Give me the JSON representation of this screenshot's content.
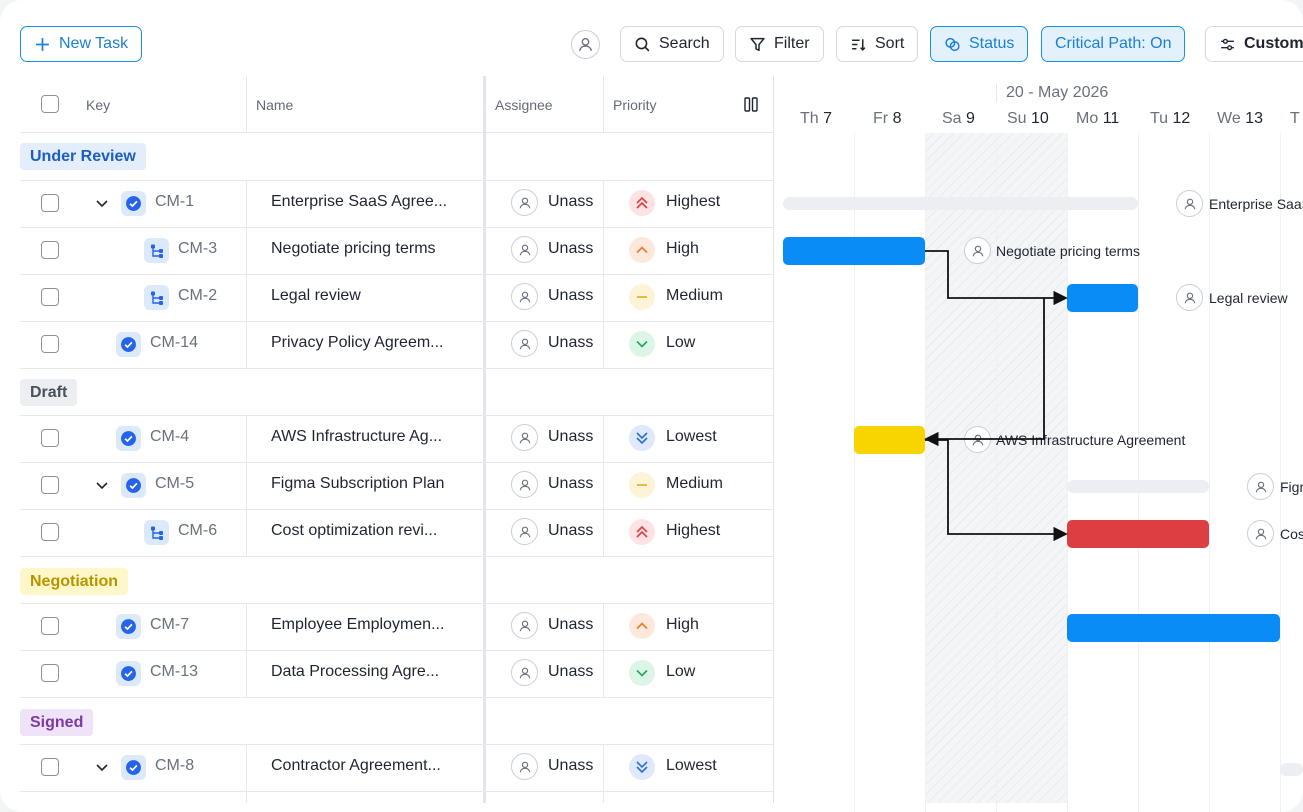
{
  "toolbar": {
    "new_task": "New Task",
    "search": "Search",
    "filter": "Filter",
    "sort": "Sort",
    "status": "Status",
    "critical_path": "Critical Path: On",
    "customize": "Customize"
  },
  "columns": {
    "key": "Key",
    "name": "Name",
    "assignee": "Assignee",
    "priority": "Priority"
  },
  "timeline": {
    "month": "20 - May 2026",
    "days": [
      {
        "dow": "Th",
        "num": "7"
      },
      {
        "dow": "Fr",
        "num": "8"
      },
      {
        "dow": "Sa",
        "num": "9"
      },
      {
        "dow": "Su",
        "num": "10"
      },
      {
        "dow": "Mo",
        "num": "11"
      },
      {
        "dow": "Tu",
        "num": "12"
      },
      {
        "dow": "We",
        "num": "13"
      },
      {
        "dow": "T",
        "num": ""
      }
    ]
  },
  "groups": [
    {
      "label": "Under Review",
      "bg": "#e3edfb",
      "color": "#1d5fbf"
    },
    {
      "label": "Draft",
      "bg": "#eceef1",
      "color": "#4a515c"
    },
    {
      "label": "Negotiation",
      "bg": "#fdf7c9",
      "color": "#b79500"
    },
    {
      "label": "Signed",
      "bg": "#efe3f8",
      "color": "#7b3aa6"
    }
  ],
  "rows": [
    {
      "key": "CM-1",
      "name": "Enterprise SaaS Agree...",
      "assignee": "Unass",
      "priority": "Highest"
    },
    {
      "key": "CM-3",
      "name": "Negotiate pricing terms",
      "assignee": "Unass",
      "priority": "High"
    },
    {
      "key": "CM-2",
      "name": "Legal review",
      "assignee": "Unass",
      "priority": "Medium"
    },
    {
      "key": "CM-14",
      "name": "Privacy Policy Agreem...",
      "assignee": "Unass",
      "priority": "Low"
    },
    {
      "key": "CM-4",
      "name": "AWS Infrastructure Ag...",
      "assignee": "Unass",
      "priority": "Lowest"
    },
    {
      "key": "CM-5",
      "name": "Figma Subscription Plan",
      "assignee": "Unass",
      "priority": "Medium"
    },
    {
      "key": "CM-6",
      "name": "Cost optimization revi...",
      "assignee": "Unass",
      "priority": "Highest"
    },
    {
      "key": "CM-7",
      "name": "Employee Employmen...",
      "assignee": "Unass",
      "priority": "High"
    },
    {
      "key": "CM-13",
      "name": "Data Processing Agre...",
      "assignee": "Unass",
      "priority": "Low"
    },
    {
      "key": "CM-8",
      "name": "Contractor Agreement...",
      "assignee": "Unass",
      "priority": "Lowest"
    }
  ],
  "gantt_labels": {
    "cm1": "Enterprise SaaS Agreement",
    "cm3": "Negotiate pricing terms",
    "cm2": "Legal review",
    "cm4": "AWS Infrastructure Agreement",
    "cm5": "Figma Subscription Plan",
    "cm6": "Cost optimization review"
  },
  "colors": {
    "accent": "#1b8fe6",
    "bar_blue": "#0a8cf6",
    "bar_yellow": "#f9d500",
    "bar_red": "#dc3e42"
  }
}
